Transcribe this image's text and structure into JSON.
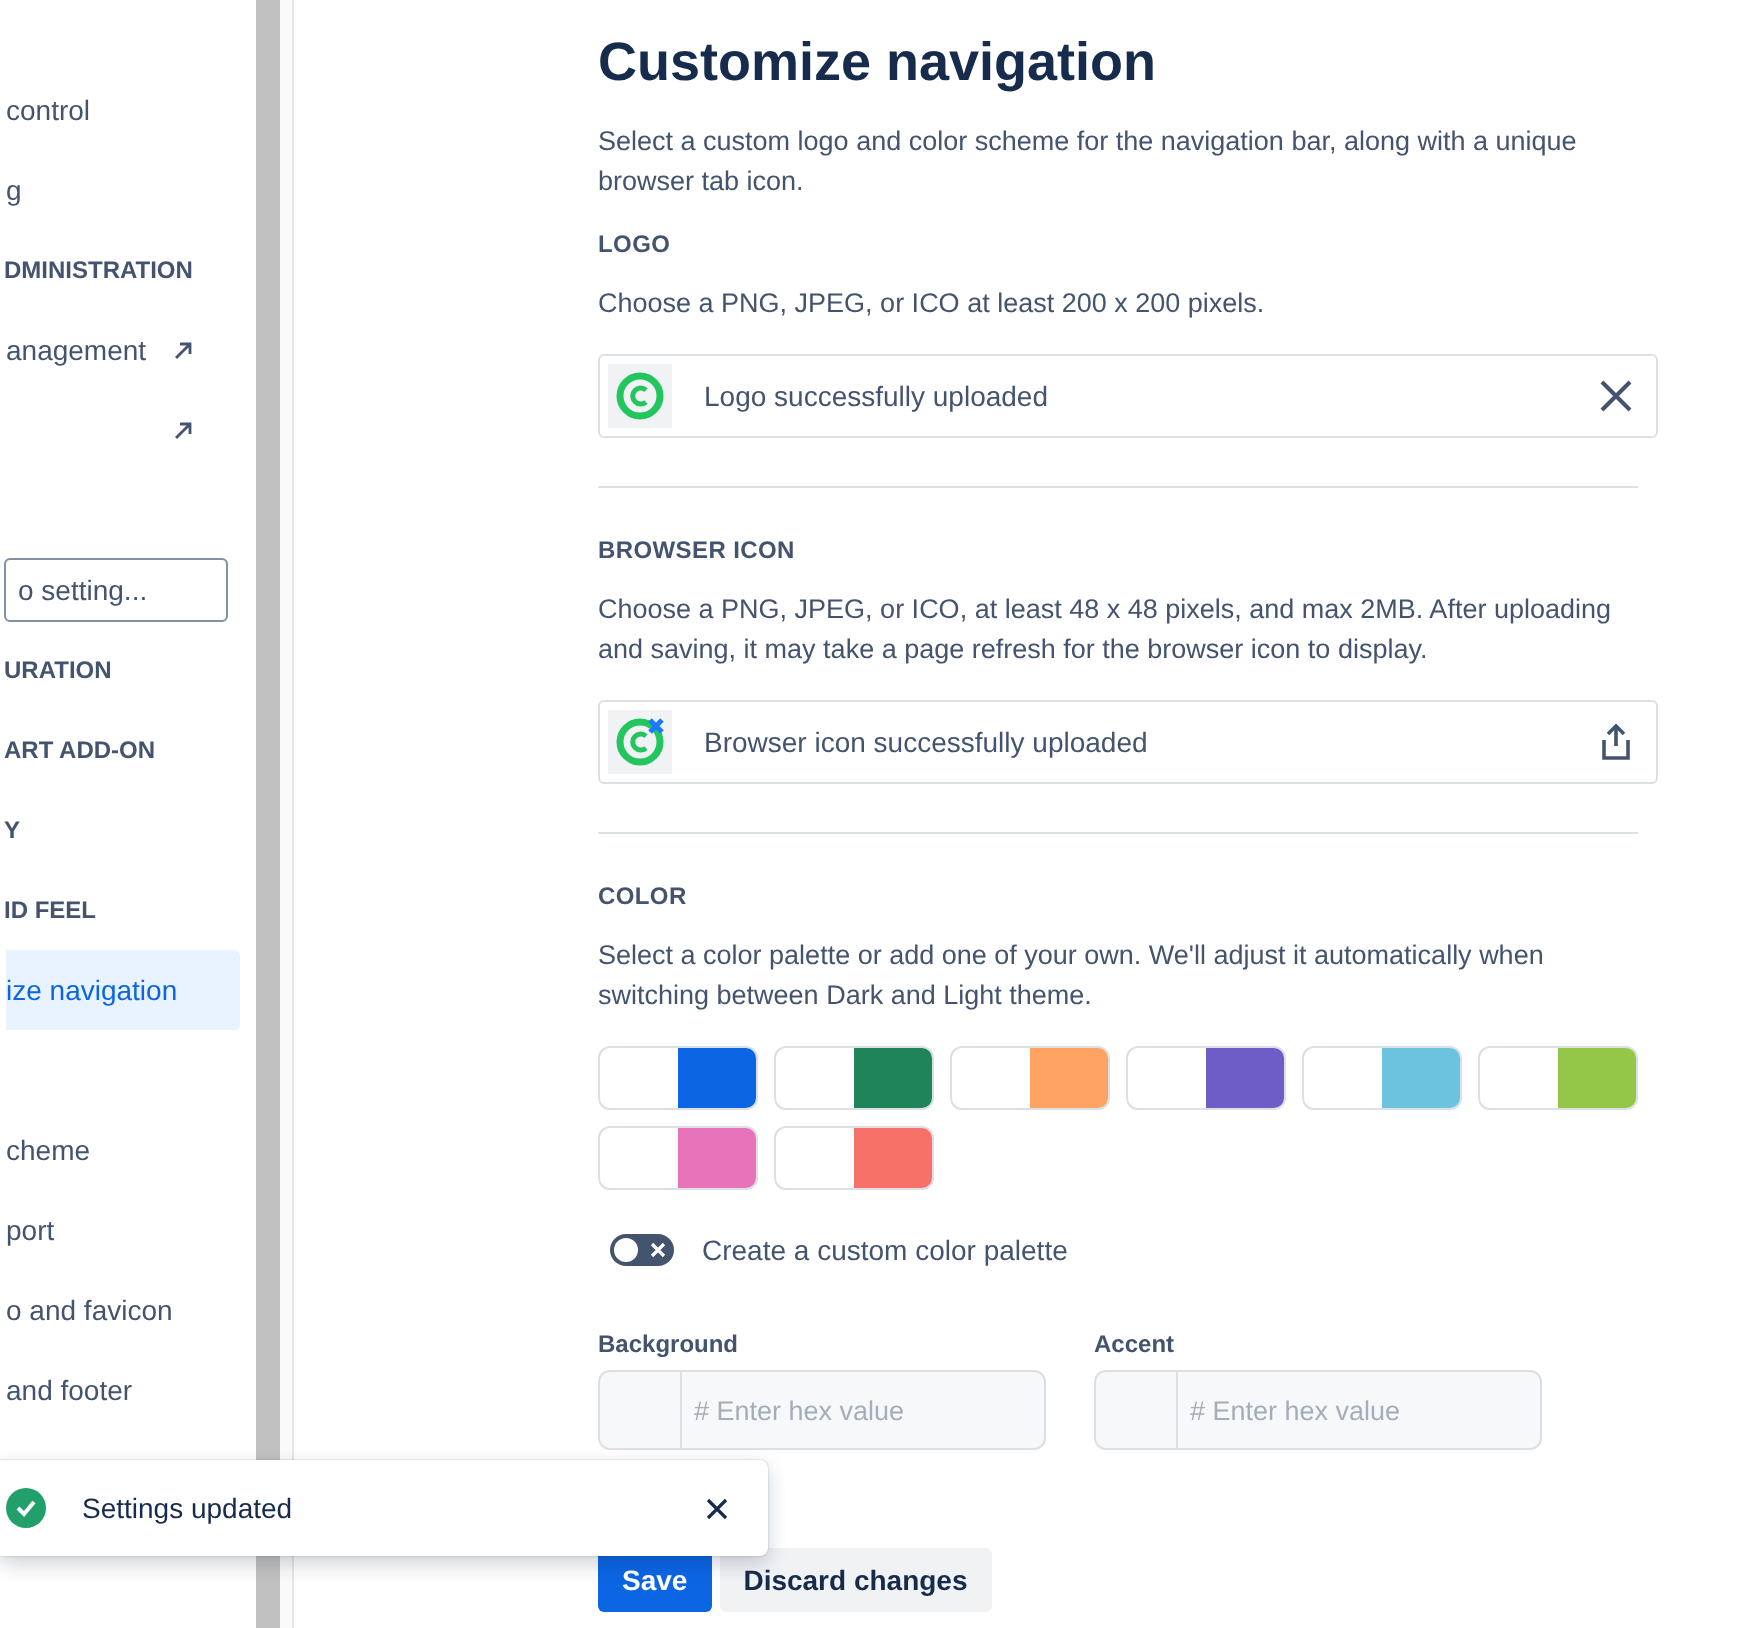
{
  "sidebar": {
    "items": [
      {
        "kind": "item",
        "label": "control",
        "external": false,
        "selected": false
      },
      {
        "kind": "item",
        "label": "g",
        "external": false,
        "selected": false
      },
      {
        "kind": "header",
        "label": "DMINISTRATION"
      },
      {
        "kind": "item",
        "label": "anagement",
        "external": true,
        "selected": false
      },
      {
        "kind": "item",
        "external": true,
        "selected": false
      },
      {
        "kind": "spacer"
      },
      {
        "kind": "search",
        "placeholder": "o setting..."
      },
      {
        "kind": "header",
        "label": "URATION"
      },
      {
        "kind": "header",
        "label": "ART ADD-ON"
      },
      {
        "kind": "header",
        "label": "Y"
      },
      {
        "kind": "header",
        "label": "ID FEEL"
      },
      {
        "kind": "item",
        "label": "ize navigation",
        "external": false,
        "selected": true
      },
      {
        "kind": "small"
      },
      {
        "kind": "item",
        "label": "cheme",
        "external": false,
        "selected": false
      },
      {
        "kind": "item",
        "label": "port",
        "external": false,
        "selected": false
      },
      {
        "kind": "item",
        "label": "o and favicon",
        "external": false,
        "selected": false
      },
      {
        "kind": "item",
        "label": "and footer",
        "external": false,
        "selected": false
      }
    ]
  },
  "page": {
    "title": "Customize navigation",
    "description": "Select a custom logo and color scheme for the navigation bar, along with a unique browser tab icon.",
    "logo": {
      "heading": "LOGO",
      "hint": "Choose a PNG, JPEG, or ICO at least 200 x 200 pixels.",
      "status": "Logo successfully uploaded",
      "kind": "removable"
    },
    "browser_icon": {
      "heading": "BROWSER ICON",
      "hint": "Choose a PNG, JPEG, or ICO, at least 48 x 48 pixels, and max 2MB. After uploading and saving, it may take a page refresh for the browser icon to display.",
      "status": "Browser icon successfully uploaded",
      "kind": "uploadable"
    },
    "color": {
      "heading": "COLOR",
      "hint": "Select a color palette or add one of your own. We'll adjust it automatically when switching between Dark and Light theme.",
      "palettes": [
        {
          "color": "#0c66e4"
        },
        {
          "color": "#1f845a"
        },
        {
          "color": "#fea362"
        },
        {
          "color": "#6e5dc6"
        },
        {
          "color": "#6cc3e0"
        },
        {
          "color": "#94c748"
        },
        {
          "color": "#e774bb"
        },
        {
          "color": "#f87168"
        }
      ],
      "custom_toggle": {
        "label": "Create a custom color palette",
        "on": false
      },
      "fields": [
        {
          "label": "Background",
          "placeholder": "# Enter hex value"
        },
        {
          "label": "Accent",
          "placeholder": "# Enter hex value"
        }
      ]
    },
    "buttons": [
      {
        "label": "Save",
        "kind": "primary"
      },
      {
        "label": "Discard changes",
        "kind": "secondary"
      }
    ]
  },
  "toast": {
    "message": "Settings updated"
  }
}
